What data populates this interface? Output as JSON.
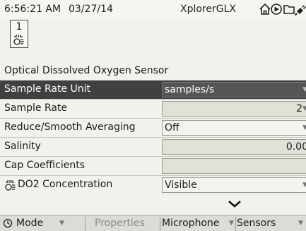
{
  "status_bar": {
    "time": "6:56:21 AM",
    "date": "03/27/14",
    "app_name": "XplorerGLX",
    "icons": [
      "home-icon",
      "play-icon",
      "folder-icon",
      "power-plug-icon"
    ]
  },
  "sensor_tile": {
    "number": "1",
    "icon": "sensor-icon"
  },
  "sensor_title": "Optical Dissolved Oxygen Sensor",
  "properties": [
    {
      "label": "Sample Rate Unit",
      "value": "samples/s",
      "type": "select",
      "selected": true
    },
    {
      "label": "Sample Rate",
      "value": "2",
      "type": "select",
      "selected": false
    },
    {
      "label": "Reduce/Smooth Averaging",
      "value": "Off",
      "type": "select",
      "selected": false
    },
    {
      "label": "Salinity",
      "value": "0.00",
      "type": "input",
      "selected": false
    },
    {
      "label": "Cap Coefficients",
      "value": "",
      "type": "input",
      "selected": false
    },
    {
      "label": "DO2 Concentration",
      "value": "Visible",
      "type": "select",
      "selected": false,
      "icon": "sensor-icon"
    }
  ],
  "softkeys": [
    {
      "label": "Mode",
      "icon": "clock-icon",
      "has_menu": true,
      "enabled": true
    },
    {
      "label": "Properties",
      "has_menu": false,
      "enabled": false
    },
    {
      "label": "Microphone",
      "has_menu": true,
      "enabled": true
    },
    {
      "label": "Sensors",
      "has_menu": true,
      "enabled": true
    }
  ],
  "colors": {
    "background": "#f2f2ec",
    "selected_row": "#404040",
    "input_field": "#e1e1da",
    "softkey_bar": "#dcdcd6"
  }
}
